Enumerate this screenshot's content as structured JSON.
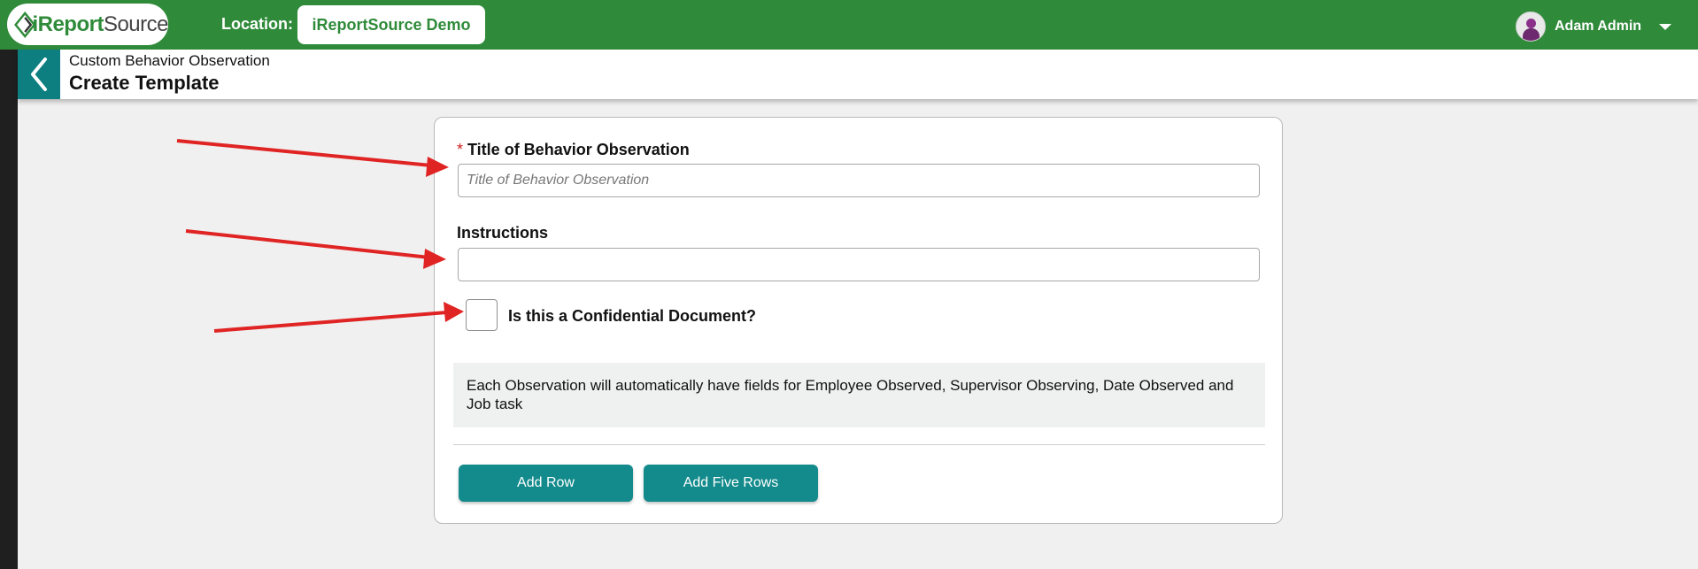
{
  "brand": {
    "logo_word_a": "iReport",
    "logo_word_b": "Source",
    "primary_color": "#2f8b3a",
    "accent_color": "#0e7f80"
  },
  "topbar": {
    "location_label": "Location:",
    "location_value": "iReportSource Demo",
    "user_name": "Adam Admin"
  },
  "header": {
    "breadcrumb": "Custom Behavior Observation",
    "title": "Create Template"
  },
  "form": {
    "title_field": {
      "required_marker": "*",
      "label": "Title of Behavior Observation",
      "placeholder": "Title of Behavior Observation",
      "value": ""
    },
    "instructions_field": {
      "label": "Instructions",
      "value": ""
    },
    "confidential": {
      "label": "Is this a Confidential Document?",
      "checked": false
    },
    "info_text": "Each Observation will automatically have fields for Employee Observed, Supervisor Observing, Date Observed and Job task",
    "buttons": {
      "add_row": "Add Row",
      "add_five_rows": "Add Five Rows"
    }
  },
  "annotation_color": "#e02424"
}
